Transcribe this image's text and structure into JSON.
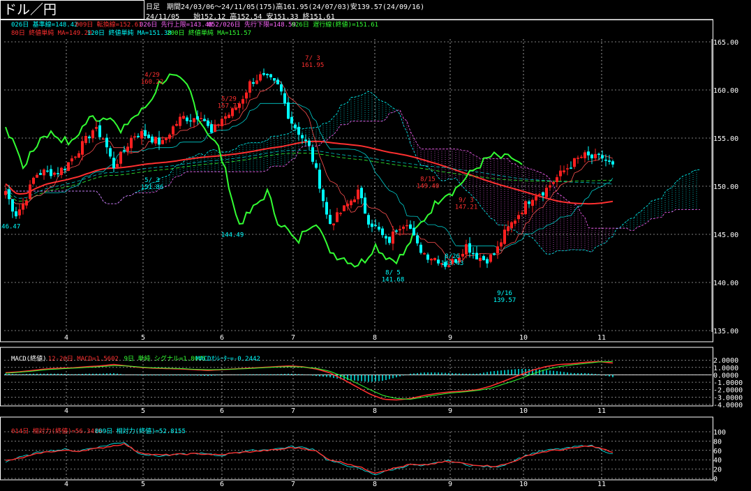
{
  "header": {
    "title": "ドル／円",
    "info_line1": "日足　期間24/03/06〜24/11/05(175)高161.95(24/07/03)安139.57(24/09/16)",
    "info_line2": "24/11/05　　始152.12 高152.54 安151.33 終151.61"
  },
  "legend_main_1": [
    {
      "text": "026日 基準線=148.42",
      "color": "#00ffff"
    },
    {
      "text": "009日 転換線=152.61",
      "color": "#ff3030"
    },
    {
      "text": "026日 先行上限=143.48",
      "color": "#ff66ff"
    },
    {
      "text": "052/026日 先行下限=148.59",
      "color": "#ff66ff"
    },
    {
      "text": "026日 遅行線(終値)=151.61",
      "color": "#33ff33"
    }
  ],
  "legend_main_2": [
    {
      "text": "80日 終値単純 MA=149.20",
      "color": "#ff3030"
    },
    {
      "text": "120日 終値単純 MA=151.38",
      "color": "#00ffff"
    },
    {
      "text": "200日 終値単純 MA=151.57",
      "color": "#33ff33"
    }
  ],
  "legend_macd": [
    {
      "text": "MACD(終値)",
      "color": "#ffffff"
    },
    {
      "text": "12-26日 MACD=1.5602",
      "color": "#ff3030"
    },
    {
      "text": "9日 単純 シグナル=1.8045",
      "color": "#33ff33"
    },
    {
      "text": "MACDｵｼﾚｰﾀｰ=-0.2442",
      "color": "#00ffff"
    }
  ],
  "legend_rsi": [
    {
      "text": "014日 相対力(終値)=56.3415",
      "color": "#ff3030"
    },
    {
      "text": "009日 相対力(終値)=52.8155",
      "color": "#00ffff"
    }
  ],
  "colors": {
    "up": "#ff2020",
    "down": "#00ffff",
    "grid": "#ffffff",
    "kumo_upper": "#ff66ff",
    "kumo_lower": "#00ffff",
    "lagging": "#33ff33",
    "ma80": "#ff3030"
  },
  "chart_data": [
    {
      "type": "candlestick",
      "x_axis_ticks": [
        "4",
        "5",
        "6",
        "7",
        "8",
        "9",
        "10",
        "11"
      ],
      "ylim": [
        135,
        165
      ],
      "y_ticks": [
        "165.00",
        "160.00",
        "155.00",
        "150.00",
        "145.00",
        "140.00",
        "135.00"
      ],
      "y_tick_values": [
        165,
        160,
        155,
        150,
        145,
        140,
        135
      ],
      "annotations": [
        {
          "date_index": 42,
          "price": 160.2,
          "label": "4/29\n160.22",
          "color": "#ff3030",
          "pos": "above"
        },
        {
          "date_index": 42,
          "price": 151.3,
          "label": "5/ 3\n151.86",
          "color": "#00ffff",
          "pos": "below"
        },
        {
          "date_index": 64,
          "price": 157.7,
          "label": "5/29\n157.71",
          "color": "#ff3030",
          "pos": "above"
        },
        {
          "date_index": 88,
          "price": 161.95,
          "label": "7/ 3\n161.95",
          "color": "#ff3030",
          "pos": "above"
        },
        {
          "date_index": 111,
          "price": 141.7,
          "label": "8/ 5\n141.68",
          "color": "#00ffff",
          "pos": "below"
        },
        {
          "date_index": 121,
          "price": 149.4,
          "label": "8/15\n149.40",
          "color": "#ff3030",
          "pos": "above"
        },
        {
          "date_index": 128,
          "price": 143.4,
          "label": "8/26\n143.43",
          "color": "#00ffff",
          "pos": "below"
        },
        {
          "date_index": 132,
          "price": 147.2,
          "label": "9/ 3\n147.21",
          "color": "#ff3030",
          "pos": "above"
        },
        {
          "date_index": 143,
          "price": 139.57,
          "label": "9/16\n139.57",
          "color": "#00ffff",
          "pos": "below"
        },
        {
          "date_index": 1,
          "price": 146.5,
          "label": "146.47",
          "color": "#00ffff",
          "pos": "below"
        },
        {
          "date_index": 65,
          "price": 145.6,
          "label": "144.49",
          "color": "#00ffff",
          "pos": "below"
        }
      ],
      "ohlc_anchor_closes": [
        149.5,
        147.0,
        148.5,
        151.2,
        151.5,
        151.4,
        151.9,
        153.2,
        154.5,
        156.0,
        155.0,
        152.0,
        153.5,
        155.3,
        155.5,
        154.9,
        154.4,
        156.0,
        157.2,
        157.0,
        157.5,
        155.4,
        157.0,
        157.6,
        158.8,
        160.8,
        161.4,
        161.0,
        160.2,
        157.0,
        155.5,
        154.0,
        150.5,
        146.0,
        147.0,
        148.2,
        149.4,
        146.5,
        145.5,
        144.0,
        145.8,
        146.4,
        143.8,
        142.8,
        142.5,
        141.8,
        142.4,
        143.9,
        142.8,
        142.3,
        143.0,
        145.2,
        146.6,
        148.0,
        149.2,
        149.5,
        150.6,
        151.6,
        152.5,
        153.2,
        152.9,
        153.0,
        152.0
      ]
    },
    {
      "type": "bar_line",
      "name": "MACD",
      "ylim": [
        -4.2,
        2.4
      ],
      "y_ticks": [
        "2.0000",
        "1.0000",
        "0.0000",
        "-1.0000",
        "-2.0000",
        "-3.0000",
        "-4.0000"
      ],
      "y_tick_values": [
        2,
        1,
        0,
        -1,
        -2,
        -3,
        -4
      ],
      "macd_anchor": [
        0.3,
        0.4,
        0.6,
        0.8,
        0.9,
        0.95,
        1.1,
        1.2,
        1.4,
        1.2,
        1.0,
        0.9,
        0.85,
        0.8,
        0.7,
        0.6,
        0.7,
        0.8,
        0.9,
        1.0,
        1.1,
        1.2,
        1.1,
        0.8,
        0.3,
        -0.6,
        -1.6,
        -2.6,
        -3.3,
        -3.4,
        -3.2,
        -2.8,
        -2.5,
        -2.3,
        -2.2,
        -2.0,
        -1.5,
        -0.8,
        -0.1,
        0.6,
        1.1,
        1.4,
        1.5,
        1.7,
        1.8,
        1.6
      ],
      "signal_anchor": [
        0.2,
        0.35,
        0.5,
        0.7,
        0.8,
        0.9,
        1.0,
        1.1,
        1.25,
        1.2,
        1.05,
        0.95,
        0.9,
        0.85,
        0.75,
        0.7,
        0.72,
        0.78,
        0.85,
        0.95,
        1.05,
        1.1,
        1.05,
        0.9,
        0.5,
        -0.2,
        -1.1,
        -2.0,
        -2.8,
        -3.2,
        -3.3,
        -3.0,
        -2.7,
        -2.45,
        -2.3,
        -2.1,
        -1.8,
        -1.2,
        -0.6,
        0.1,
        0.7,
        1.1,
        1.35,
        1.55,
        1.75,
        1.8
      ]
    },
    {
      "type": "line",
      "name": "RSI",
      "ylim": [
        0,
        100
      ],
      "y_ticks": [
        "100",
        "80",
        "60",
        "40",
        "20",
        "0"
      ],
      "y_tick_values": [
        100,
        80,
        60,
        40,
        20,
        0
      ],
      "rsi14_anchor": [
        38,
        42,
        48,
        55,
        58,
        60,
        58,
        62,
        65,
        70,
        74,
        58,
        52,
        50,
        51,
        52,
        53,
        52,
        50,
        54,
        56,
        58,
        60,
        62,
        66,
        64,
        60,
        42,
        36,
        30,
        22,
        12,
        18,
        24,
        30,
        28,
        32,
        36,
        34,
        30,
        28,
        26,
        30,
        40,
        50,
        56,
        60,
        62,
        66,
        70,
        64,
        56
      ],
      "rsi9_anchor": [
        36,
        44,
        50,
        58,
        60,
        62,
        58,
        64,
        68,
        74,
        78,
        56,
        50,
        48,
        50,
        52,
        54,
        52,
        48,
        55,
        58,
        60,
        62,
        64,
        68,
        66,
        62,
        40,
        32,
        26,
        18,
        8,
        16,
        22,
        30,
        26,
        32,
        38,
        34,
        28,
        26,
        24,
        30,
        42,
        52,
        58,
        62,
        64,
        68,
        72,
        62,
        52
      ]
    }
  ]
}
